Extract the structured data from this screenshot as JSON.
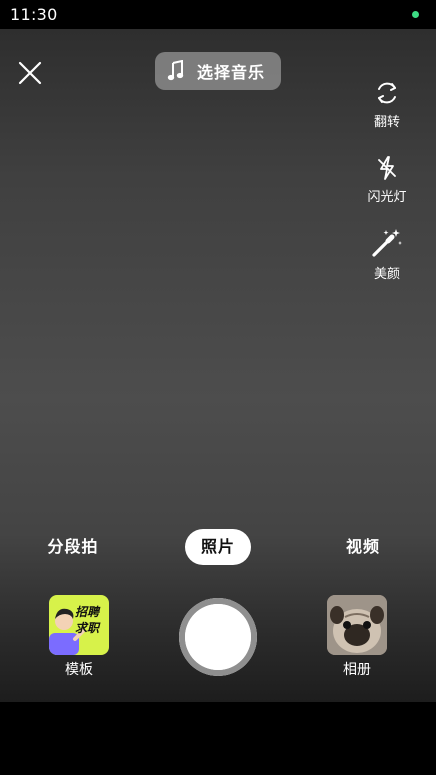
{
  "status_bar": {
    "time": "11:30",
    "indicator_color": "#3ddc84"
  },
  "top_bar": {
    "music_label": "选择音乐"
  },
  "side_tools": [
    {
      "icon": "flip-camera-icon",
      "label": "翻转"
    },
    {
      "icon": "flash-off-icon",
      "label": "闪光灯"
    },
    {
      "icon": "magic-wand-icon",
      "label": "美颜"
    }
  ],
  "modes": [
    {
      "label": "分段拍",
      "active": false
    },
    {
      "label": "照片",
      "active": true
    },
    {
      "label": "视频",
      "active": false
    }
  ],
  "bottom": {
    "template": {
      "label": "模板",
      "thumb_text": [
        "招聘",
        "求职"
      ],
      "thumb_color": "#d7f24a"
    },
    "album": {
      "label": "相册"
    }
  }
}
